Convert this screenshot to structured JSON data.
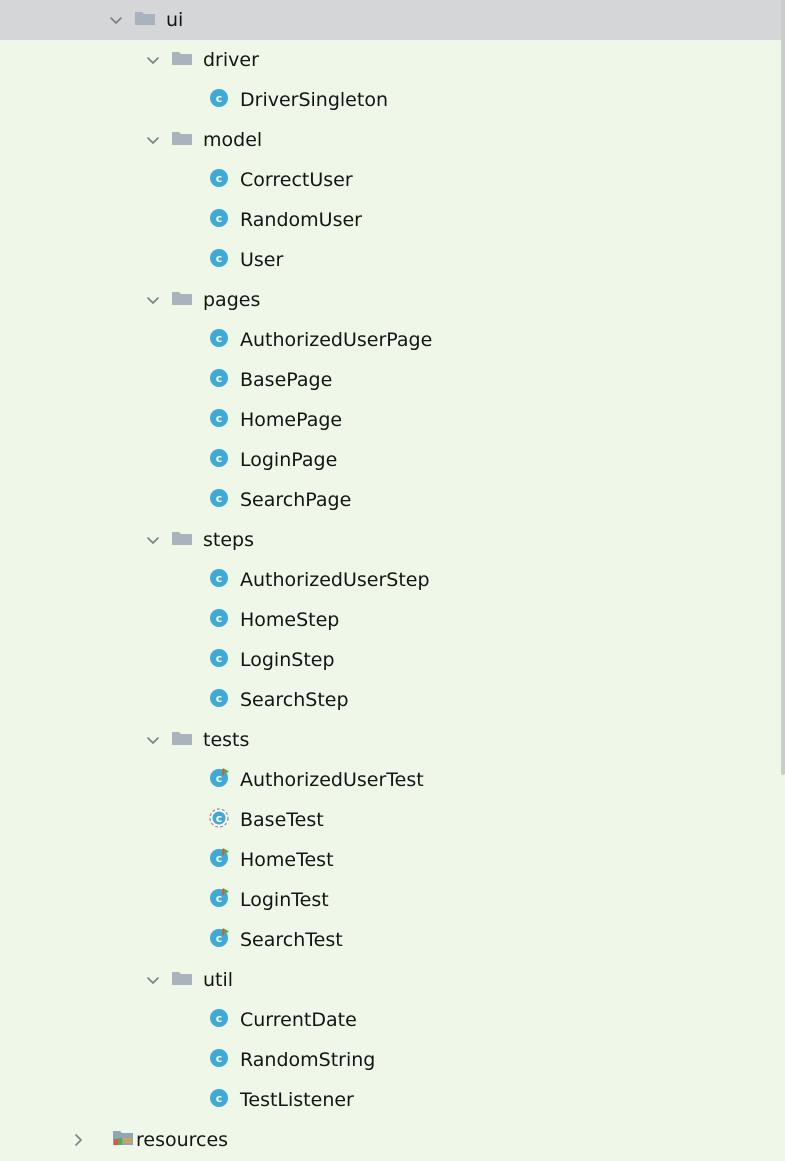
{
  "tree": [
    {
      "label": "ui",
      "kind": "folder",
      "depth": 0,
      "expanded": true,
      "selected": true
    },
    {
      "label": "driver",
      "kind": "folder",
      "depth": 1,
      "expanded": true
    },
    {
      "label": "DriverSingleton",
      "kind": "class",
      "depth": 2
    },
    {
      "label": "model",
      "kind": "folder",
      "depth": 1,
      "expanded": true
    },
    {
      "label": "CorrectUser",
      "kind": "class",
      "depth": 2
    },
    {
      "label": "RandomUser",
      "kind": "class",
      "depth": 2
    },
    {
      "label": "User",
      "kind": "class",
      "depth": 2
    },
    {
      "label": "pages",
      "kind": "folder",
      "depth": 1,
      "expanded": true
    },
    {
      "label": "AuthorizedUserPage",
      "kind": "class",
      "depth": 2
    },
    {
      "label": "BasePage",
      "kind": "class",
      "depth": 2
    },
    {
      "label": "HomePage",
      "kind": "class",
      "depth": 2
    },
    {
      "label": "LoginPage",
      "kind": "class",
      "depth": 2
    },
    {
      "label": "SearchPage",
      "kind": "class",
      "depth": 2
    },
    {
      "label": "steps",
      "kind": "folder",
      "depth": 1,
      "expanded": true
    },
    {
      "label": "AuthorizedUserStep",
      "kind": "class",
      "depth": 2
    },
    {
      "label": "HomeStep",
      "kind": "class",
      "depth": 2
    },
    {
      "label": "LoginStep",
      "kind": "class",
      "depth": 2
    },
    {
      "label": "SearchStep",
      "kind": "class",
      "depth": 2
    },
    {
      "label": "tests",
      "kind": "folder",
      "depth": 1,
      "expanded": true
    },
    {
      "label": "AuthorizedUserTest",
      "kind": "test-class",
      "depth": 2
    },
    {
      "label": "BaseTest",
      "kind": "abstract-class",
      "depth": 2
    },
    {
      "label": "HomeTest",
      "kind": "test-class",
      "depth": 2
    },
    {
      "label": "LoginTest",
      "kind": "test-class",
      "depth": 2
    },
    {
      "label": "SearchTest",
      "kind": "test-class",
      "depth": 2
    },
    {
      "label": "util",
      "kind": "folder",
      "depth": 1,
      "expanded": true
    },
    {
      "label": "CurrentDate",
      "kind": "class",
      "depth": 2
    },
    {
      "label": "RandomString",
      "kind": "class",
      "depth": 2
    },
    {
      "label": "TestListener",
      "kind": "class",
      "depth": 2
    },
    {
      "label": "resources",
      "kind": "resources-folder",
      "depth": -1,
      "expanded": false
    }
  ],
  "colors": {
    "background": "#eef7e8",
    "selection": "#d5d6d8",
    "folder": "#a9b3bd",
    "class_icon": "#3fa9d8",
    "test_marker_green": "#4caf50",
    "test_marker_red": "#e8533f"
  },
  "icons": {
    "folder": "folder-icon",
    "class": "class-icon",
    "test-class": "test-class-icon",
    "abstract-class": "abstract-class-icon",
    "resources-folder": "resources-folder-icon",
    "expanded": "chevron-down-icon",
    "collapsed": "chevron-right-icon"
  }
}
